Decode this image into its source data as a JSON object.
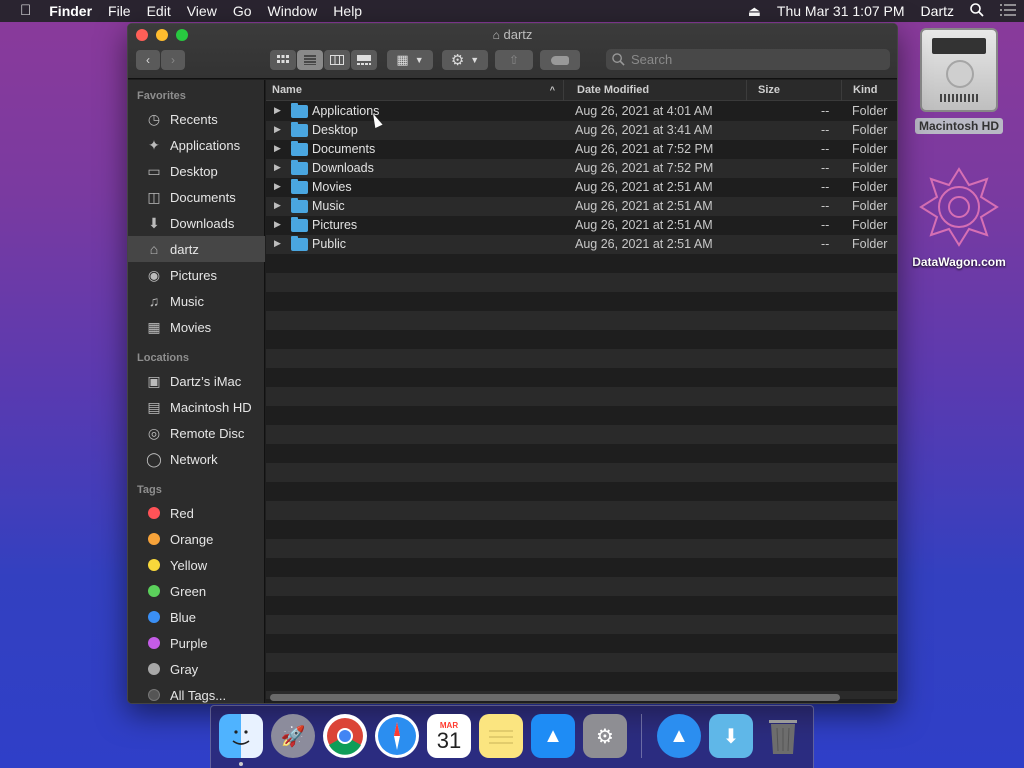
{
  "menubar": {
    "app": "Finder",
    "items": [
      "File",
      "Edit",
      "View",
      "Go",
      "Window",
      "Help"
    ],
    "datetime": "Thu Mar 31  1:07 PM",
    "user": "Dartz"
  },
  "window": {
    "title": "dartz",
    "search_placeholder": "Search"
  },
  "sidebar": {
    "favorites_header": "Favorites",
    "favorites": [
      {
        "label": "Recents",
        "icon": "clock-icon"
      },
      {
        "label": "Applications",
        "icon": "applications-icon"
      },
      {
        "label": "Desktop",
        "icon": "desktop-icon"
      },
      {
        "label": "Documents",
        "icon": "documents-icon"
      },
      {
        "label": "Downloads",
        "icon": "downloads-icon"
      },
      {
        "label": "dartz",
        "icon": "home-icon",
        "selected": true
      },
      {
        "label": "Pictures",
        "icon": "camera-icon"
      },
      {
        "label": "Music",
        "icon": "music-icon"
      },
      {
        "label": "Movies",
        "icon": "film-icon"
      }
    ],
    "locations_header": "Locations",
    "locations": [
      {
        "label": "Dartz’s iMac",
        "icon": "imac-icon"
      },
      {
        "label": "Macintosh HD",
        "icon": "disk-icon"
      },
      {
        "label": "Remote Disc",
        "icon": "disc-icon"
      },
      {
        "label": "Network",
        "icon": "globe-icon"
      }
    ],
    "tags_header": "Tags",
    "tags": [
      {
        "label": "Red",
        "color": "#ff5257"
      },
      {
        "label": "Orange",
        "color": "#f7a33a"
      },
      {
        "label": "Yellow",
        "color": "#f8d83b"
      },
      {
        "label": "Green",
        "color": "#5bd05b"
      },
      {
        "label": "Blue",
        "color": "#3a8ff5"
      },
      {
        "label": "Purple",
        "color": "#c45ce6"
      },
      {
        "label": "Gray",
        "color": "#a8a8a8"
      },
      {
        "label": "All Tags...",
        "color": "#555555"
      }
    ]
  },
  "columns": {
    "name": "Name",
    "date": "Date Modified",
    "size": "Size",
    "kind": "Kind"
  },
  "files": [
    {
      "name": "Applications",
      "date": "Aug 26, 2021 at 4:01 AM",
      "size": "--",
      "kind": "Folder"
    },
    {
      "name": "Desktop",
      "date": "Aug 26, 2021 at 3:41 AM",
      "size": "--",
      "kind": "Folder"
    },
    {
      "name": "Documents",
      "date": "Aug 26, 2021 at 7:52 PM",
      "size": "--",
      "kind": "Folder"
    },
    {
      "name": "Downloads",
      "date": "Aug 26, 2021 at 7:52 PM",
      "size": "--",
      "kind": "Folder"
    },
    {
      "name": "Movies",
      "date": "Aug 26, 2021 at 2:51 AM",
      "size": "--",
      "kind": "Folder"
    },
    {
      "name": "Music",
      "date": "Aug 26, 2021 at 2:51 AM",
      "size": "--",
      "kind": "Folder"
    },
    {
      "name": "Pictures",
      "date": "Aug 26, 2021 at 2:51 AM",
      "size": "--",
      "kind": "Folder"
    },
    {
      "name": "Public",
      "date": "Aug 26, 2021 at 2:51 AM",
      "size": "--",
      "kind": "Folder"
    }
  ],
  "desktop": {
    "hd_label": "Macintosh HD",
    "datawagon_label": "DataWagon.com"
  },
  "dock": {
    "calendar_month": "MAR",
    "calendar_day": "31"
  }
}
